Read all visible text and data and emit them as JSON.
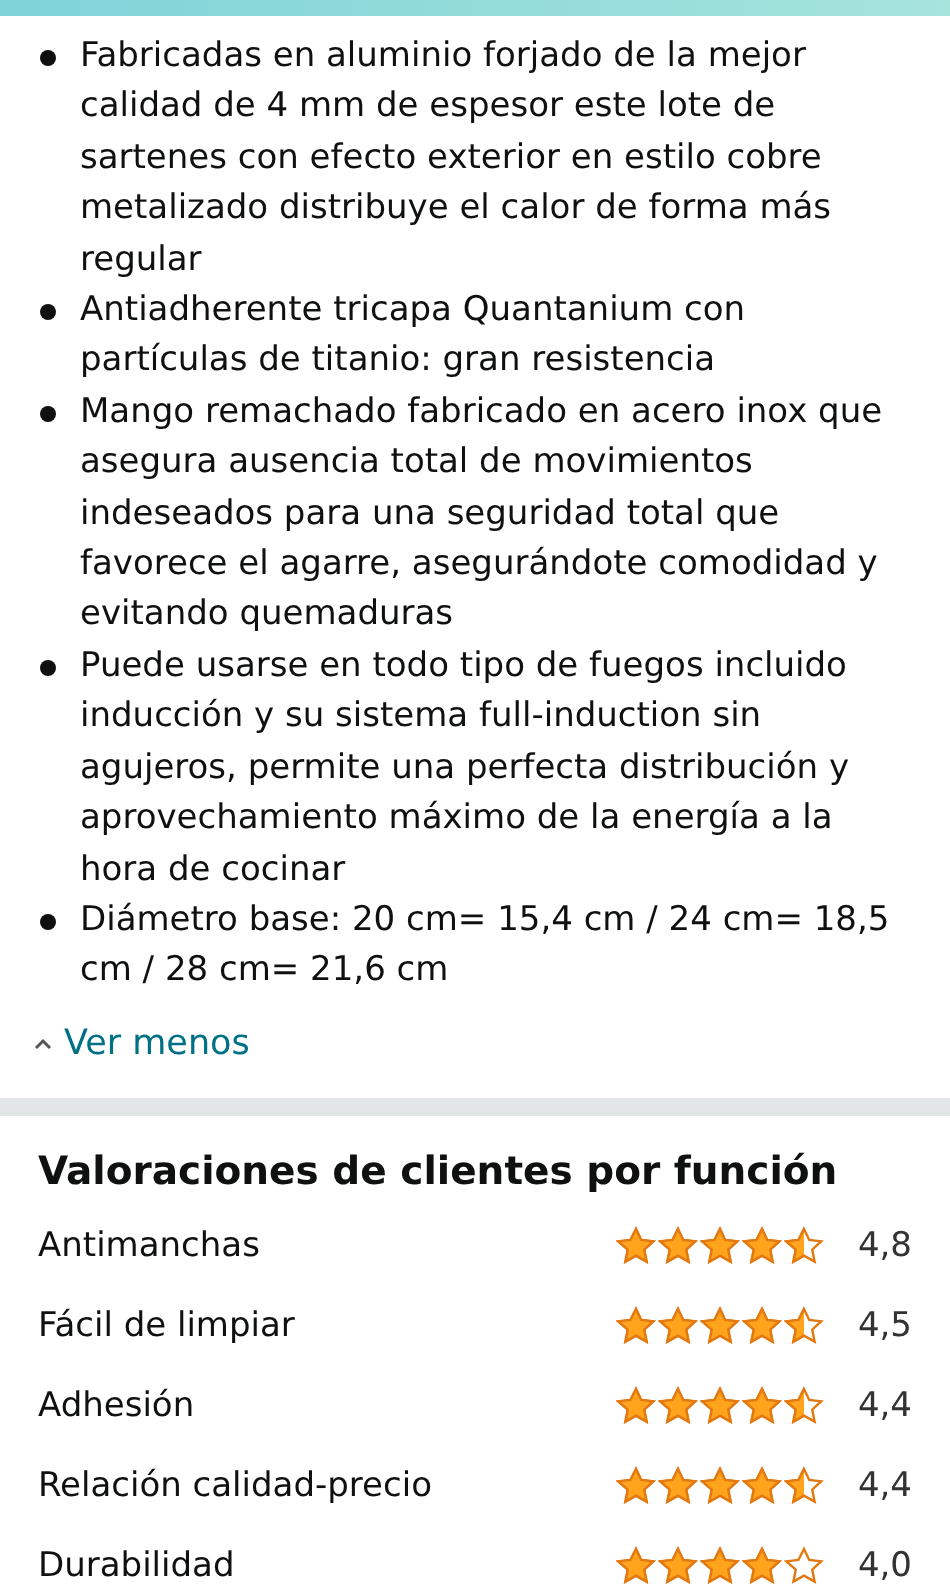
{
  "bullets": [
    "Fabricadas en aluminio forjado de la mejor calidad de 4 mm de espesor este lote de sartenes con efecto exterior en estilo cobre metalizado distribuye el calor de forma más regular",
    "Antiadherente tricapa Quantanium con partículas de titanio: gran resistencia",
    "Mango remachado fabricado en acero inox que asegura ausencia total de movimientos indeseados para una seguridad total que favorece el agarre, asegurándote comodidad y evitando quemaduras",
    "Puede usarse en todo tipo de fuegos incluido inducción y su sistema full-induction sin agujeros, permite una perfecta distribución y aprovechamiento máximo de la energía a la hora de cocinar",
    "Diámetro base: 20 cm= 15,4 cm / 24 cm= 18,5 cm / 28 cm= 21,6 cm"
  ],
  "see_less": "Ver menos",
  "ratings": {
    "title": "Valoraciones de clientes por función",
    "rows": [
      {
        "name": "Antimanchas",
        "stars": 4.5,
        "value": "4,8"
      },
      {
        "name": "Fácil de limpiar",
        "stars": 4.5,
        "value": "4,5"
      },
      {
        "name": "Adhesión",
        "stars": 4.5,
        "value": "4,4"
      },
      {
        "name": "Relación calidad-precio",
        "stars": 4.5,
        "value": "4,4"
      },
      {
        "name": "Durabilidad",
        "stars": 4,
        "value": "4,0"
      }
    ]
  }
}
